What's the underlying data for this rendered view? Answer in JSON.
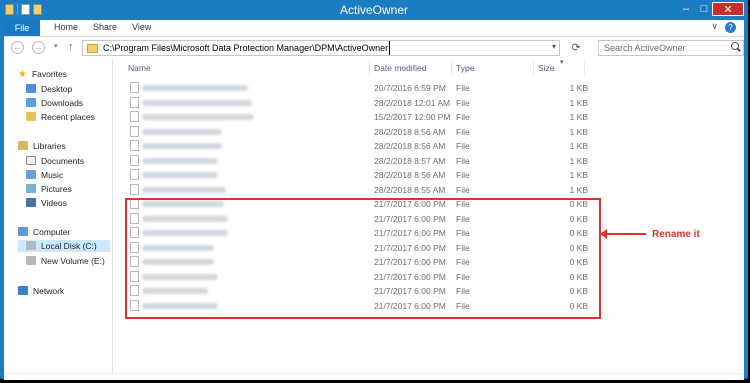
{
  "window": {
    "title": "ActiveOwner",
    "minimize_label": "–",
    "maximize_label": "□",
    "close_label": "✕"
  },
  "quick_access": {
    "dropdown": "▾"
  },
  "ribbon": {
    "tabs": [
      "File",
      "Home",
      "Share",
      "View"
    ],
    "expand": "∨",
    "help": "?"
  },
  "nav": {
    "back": "←",
    "forward": "→",
    "recent": "▾",
    "up": "↑",
    "refresh": "⟳"
  },
  "address": {
    "path": "C:\\Program Files\\Microsoft Data Protection Manager\\DPM\\ActiveOwner",
    "dropdown": "▾"
  },
  "search": {
    "placeholder": "Search ActiveOwner"
  },
  "navpane": {
    "favorites": {
      "header": "Favorites",
      "items": [
        "Desktop",
        "Downloads",
        "Recent places"
      ]
    },
    "libraries": {
      "header": "Libraries",
      "items": [
        "Documents",
        "Music",
        "Pictures",
        "Videos"
      ]
    },
    "computer": {
      "header": "Computer",
      "items": [
        "Local Disk (C:)",
        "New Volume (E:)"
      ]
    },
    "network": {
      "header": "Network"
    }
  },
  "columns": {
    "name": "Name",
    "date": "Date modified",
    "type": "Type",
    "size": "Size",
    "sort_indicator": "▾"
  },
  "files": [
    {
      "date": "20/7/2016 6:59 PM",
      "type": "File",
      "size": "1 KB"
    },
    {
      "date": "28/2/2018 12:01 AM",
      "type": "File",
      "size": "1 KB"
    },
    {
      "date": "15/2/2017 12:00 PM",
      "type": "File",
      "size": "1 KB"
    },
    {
      "date": "28/2/2018 8:56 AM",
      "type": "File",
      "size": "1 KB"
    },
    {
      "date": "28/2/2018 8:56 AM",
      "type": "File",
      "size": "1 KB"
    },
    {
      "date": "28/2/2018 8:57 AM",
      "type": "File",
      "size": "1 KB"
    },
    {
      "date": "28/2/2018 8:56 AM",
      "type": "File",
      "size": "1 KB"
    },
    {
      "date": "28/2/2018 8:55 AM",
      "type": "File",
      "size": "1 KB"
    },
    {
      "date": "21/7/2017 6:00 PM",
      "type": "File",
      "size": "0 KB"
    },
    {
      "date": "21/7/2017 6:00 PM",
      "type": "File",
      "size": "0 KB"
    },
    {
      "date": "21/7/2017 6:00 PM",
      "type": "File",
      "size": "0 KB"
    },
    {
      "date": "21/7/2017 6:00 PM",
      "type": "File",
      "size": "0 KB"
    },
    {
      "date": "21/7/2017 6:00 PM",
      "type": "File",
      "size": "0 KB"
    },
    {
      "date": "21/7/2017 6:00 PM",
      "type": "File",
      "size": "0 KB"
    },
    {
      "date": "21/7/2017 6:00 PM",
      "type": "File",
      "size": "0 KB"
    },
    {
      "date": "21/7/2017 6:00 PM",
      "type": "File",
      "size": "0 KB"
    }
  ],
  "annotation": {
    "text": "Rename it",
    "color": "#e23030"
  },
  "colors": {
    "accent": "#1a7cc2",
    "close": "#c7302a",
    "selected": "#cce8ff"
  }
}
